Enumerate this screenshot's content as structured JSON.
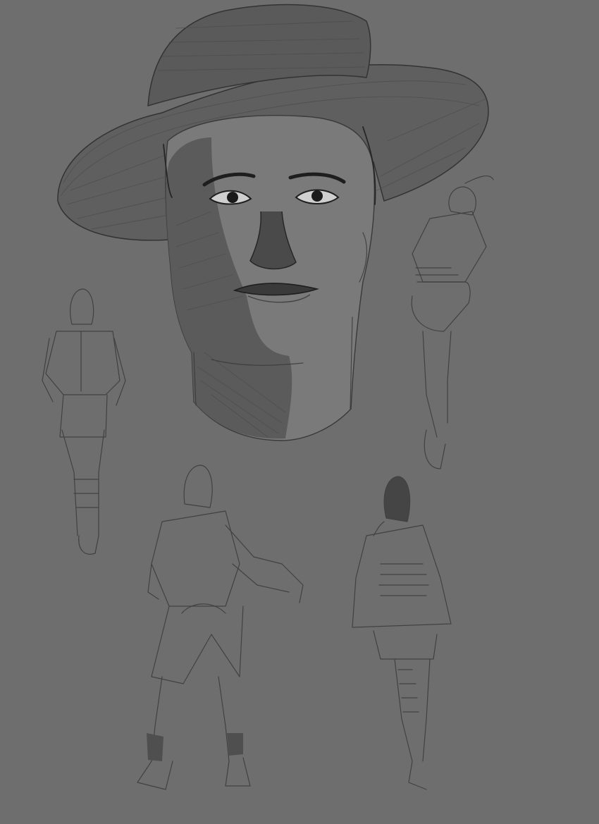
{
  "artwork": {
    "background_color": "#6e6e6e",
    "line_color": "#3a3a3a",
    "shadow_color": "#4f4f4f",
    "subjects": [
      {
        "name": "portrait-with-hat",
        "description_hidden": true
      },
      {
        "name": "figure-sketch-left"
      },
      {
        "name": "figure-sketch-right"
      },
      {
        "name": "figure-sketch-bottom-left"
      },
      {
        "name": "figure-sketch-bottom-right"
      }
    ]
  }
}
